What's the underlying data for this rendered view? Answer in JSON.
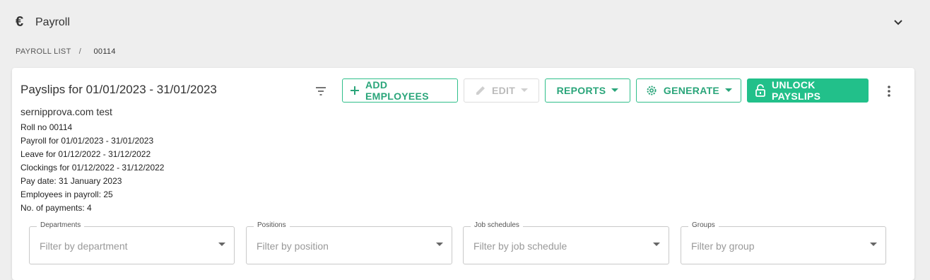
{
  "header": {
    "icon": "euro-icon",
    "title": "Payroll",
    "collapse_icon": "chevron-down-icon"
  },
  "breadcrumb": {
    "items": [
      "PAYROLL LIST",
      "00114"
    ],
    "separator": "/"
  },
  "card": {
    "title": "Payslips for 01/01/2023 - 31/01/2023",
    "company": "sernipprova.com test",
    "details": [
      "Roll no 00114",
      "Payroll for 01/01/2023 - 31/01/2023",
      "Leave for 01/12/2022 - 31/12/2022",
      "Clockings for 01/12/2022 - 31/12/2022",
      "Pay date: 31 January 2023",
      "Employees in payroll: 25",
      "No. of payments: 4"
    ]
  },
  "toolbar": {
    "filter_icon": "filter-list-icon",
    "add_employees": "ADD EMPLOYEES",
    "edit": "EDIT",
    "reports": "REPORTS",
    "generate": "GENERATE",
    "unlock_payslips": "UNLOCK PAYSLIPS",
    "more_icon": "more-vertical-icon"
  },
  "filters": [
    {
      "label": "Departments",
      "placeholder": "Filter by department"
    },
    {
      "label": "Positions",
      "placeholder": "Filter by position"
    },
    {
      "label": "Job schedules",
      "placeholder": "Filter by job schedule"
    },
    {
      "label": "Groups",
      "placeholder": "Filter by group"
    }
  ],
  "colors": {
    "accent": "#22c08a",
    "accent_text": "#2aa57a",
    "background": "#eeeeee",
    "disabled": "#bbbbbb"
  }
}
